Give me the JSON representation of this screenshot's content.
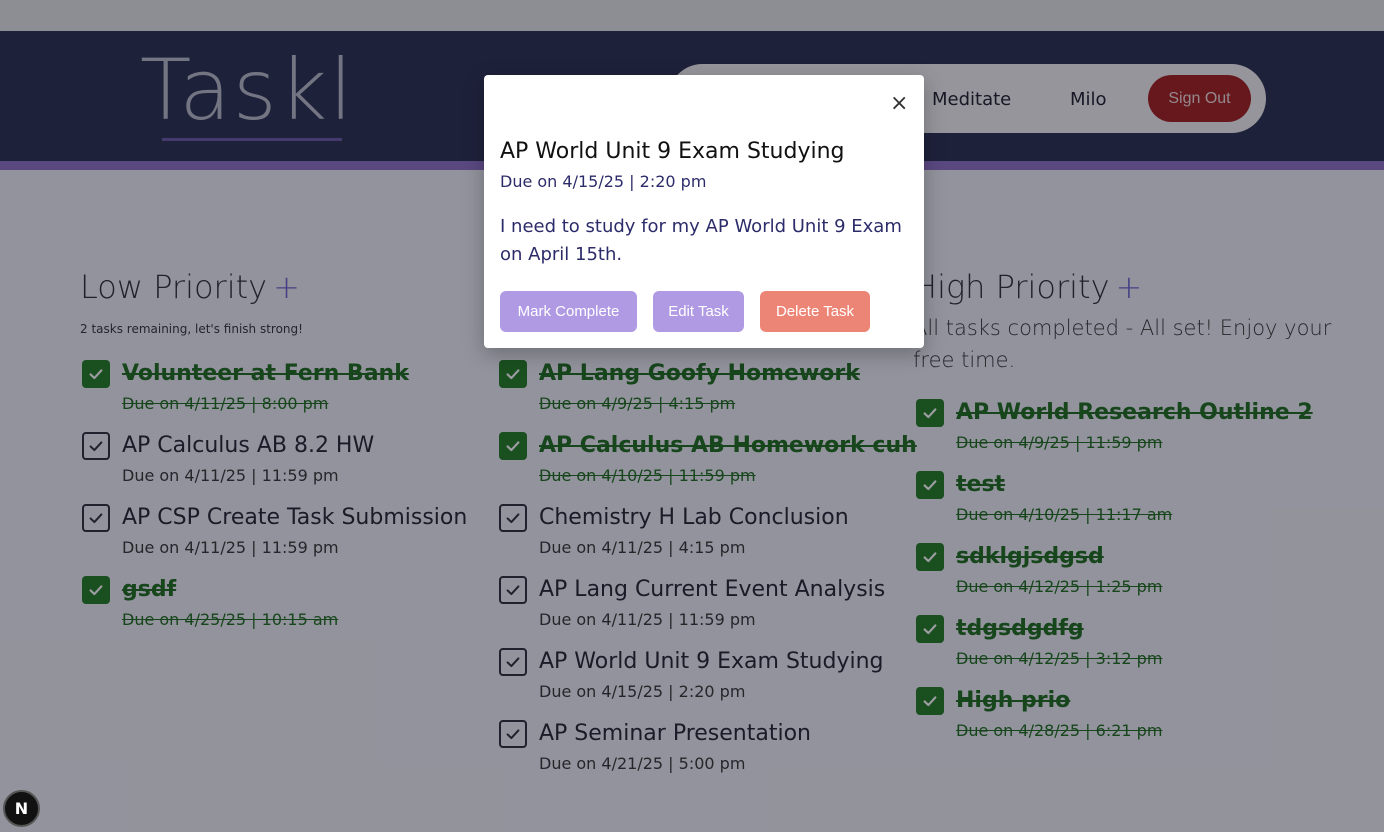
{
  "app": {
    "logo_text": "Taskl"
  },
  "nav": {
    "links": [
      "Meditate",
      "Milo"
    ],
    "signout_label": "Sign Out"
  },
  "columns": [
    {
      "title": "Low Priority",
      "plus": "+",
      "subtitle": "2 tasks remaining, let's finish strong!",
      "tasks": [
        {
          "title": "Volunteer at Fern Bank",
          "due": "Due on 4/11/25 | 8:00 pm",
          "completed": true
        },
        {
          "title": "AP Calculus AB 8.2 HW",
          "due": "Due on 4/11/25 | 11:59 pm",
          "completed": false
        },
        {
          "title": "AP CSP Create Task Submission",
          "due": "Due on 4/11/25 | 11:59 pm",
          "completed": false
        },
        {
          "title": "gsdf",
          "due": "Due on 4/25/25 | 10:15 am",
          "completed": true
        }
      ]
    },
    {
      "title": "",
      "plus": "",
      "subtitle": "",
      "tasks": [
        {
          "title": "AP Lang Goofy Homework",
          "due": "Due on 4/9/25 | 4:15 pm",
          "completed": true
        },
        {
          "title": "AP Calculus AB Homework cuh",
          "due": "Due on 4/10/25 | 11:59 pm",
          "completed": true
        },
        {
          "title": "Chemistry H Lab Conclusion",
          "due": "Due on 4/11/25 | 4:15 pm",
          "completed": false
        },
        {
          "title": "AP Lang Current Event Analysis",
          "due": "Due on 4/11/25 | 11:59 pm",
          "completed": false
        },
        {
          "title": "AP World Unit 9 Exam Studying",
          "due": "Due on 4/15/25 | 2:20 pm",
          "completed": false
        },
        {
          "title": "AP Seminar Presentation",
          "due": "Due on 4/21/25 | 5:00 pm",
          "completed": false
        }
      ]
    },
    {
      "title": "High Priority",
      "plus": "+",
      "subtitle": "All tasks completed - All set! Enjoy your free time.",
      "tasks": [
        {
          "title": "AP World Research Outline 2",
          "due": "Due on 4/9/25 | 11:59 pm",
          "completed": true
        },
        {
          "title": "test",
          "due": "Due on 4/10/25 | 11:17 am",
          "completed": true
        },
        {
          "title": "sdklgjsdgsd",
          "due": "Due on 4/12/25 | 1:25 pm",
          "completed": true
        },
        {
          "title": "tdgsdgdfg",
          "due": "Due on 4/12/25 | 3:12 pm",
          "completed": true
        },
        {
          "title": "High prio",
          "due": "Due on 4/28/25 | 6:21 pm",
          "completed": true
        }
      ]
    }
  ],
  "modal": {
    "close_glyph": "×",
    "title": "AP World Unit 9 Exam Studying",
    "due": "Due on 4/15/25 | 2:20 pm",
    "description": "I need to study for my AP World Unit 9 Exam on April 15th.",
    "buttons": {
      "complete": "Mark Complete",
      "edit": "Edit Task",
      "delete": "Delete Task"
    }
  },
  "badge": {
    "label": "N"
  },
  "colors": {
    "header_bg": "#272b4e",
    "accent_purple": "#8d6fc8",
    "done_green": "#1f7a1f",
    "signout_red": "#a31c1c",
    "button_lavender": "#b09ae4",
    "button_coral": "#ec8575"
  }
}
